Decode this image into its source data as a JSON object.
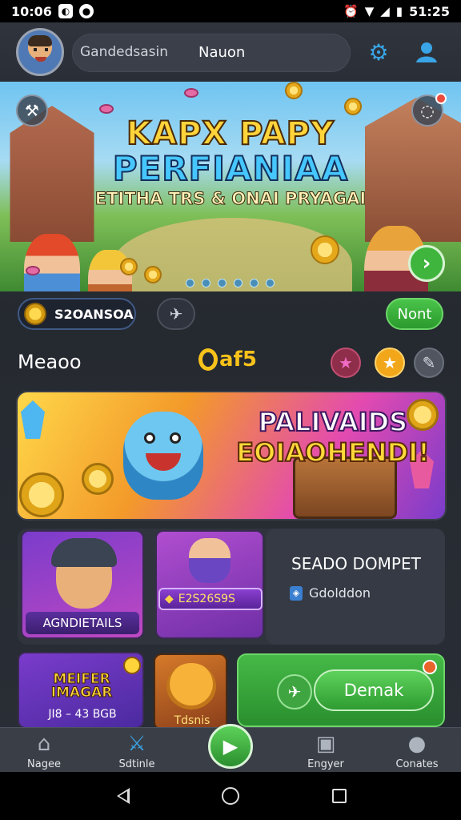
{
  "status_bar": {
    "time": "10:06",
    "battery": "51:25"
  },
  "header": {
    "search_left": "Gandedsasin",
    "search_right": "Nauon"
  },
  "hero": {
    "title_line1": "KAPX PAPY",
    "title_line2": "PERFIANIAA",
    "subtitle": "ETITHA TRS & ONAI PRYAGAI",
    "carousel_dots": 6
  },
  "balance": {
    "value": "S2OANSOA"
  },
  "next_button": {
    "label": "Nont"
  },
  "section": {
    "title": "Meaoo",
    "badge": "af5"
  },
  "promo": {
    "title_line1": "PALIVAIDS",
    "title_line2": "EOIAOHENDI!"
  },
  "cards": {
    "hero_card_label": "AGNDIETAILS",
    "mid_card_tag": "E2S26S9S",
    "info_title": "SEADO DOMPET",
    "info_line": "Gdolddon",
    "card2_left_title": "MEIFER IMAGAR",
    "card2_left_sub": "JI8 – 43 BGB",
    "card2_mid_label": "Tdsnis",
    "card2_right_button": "Demak"
  },
  "bottom_nav": {
    "items": [
      {
        "label": "Nagee",
        "icon": "home-icon"
      },
      {
        "label": "Sdtinle",
        "icon": "crossed-swords-icon"
      },
      {
        "label": "Engyer",
        "icon": "briefcase-icon"
      },
      {
        "label": "Conates",
        "icon": "person-icon"
      }
    ]
  },
  "colors": {
    "accent_green": "#3fb53e",
    "accent_blue": "#39a5e6",
    "gold": "#f8c21a"
  }
}
